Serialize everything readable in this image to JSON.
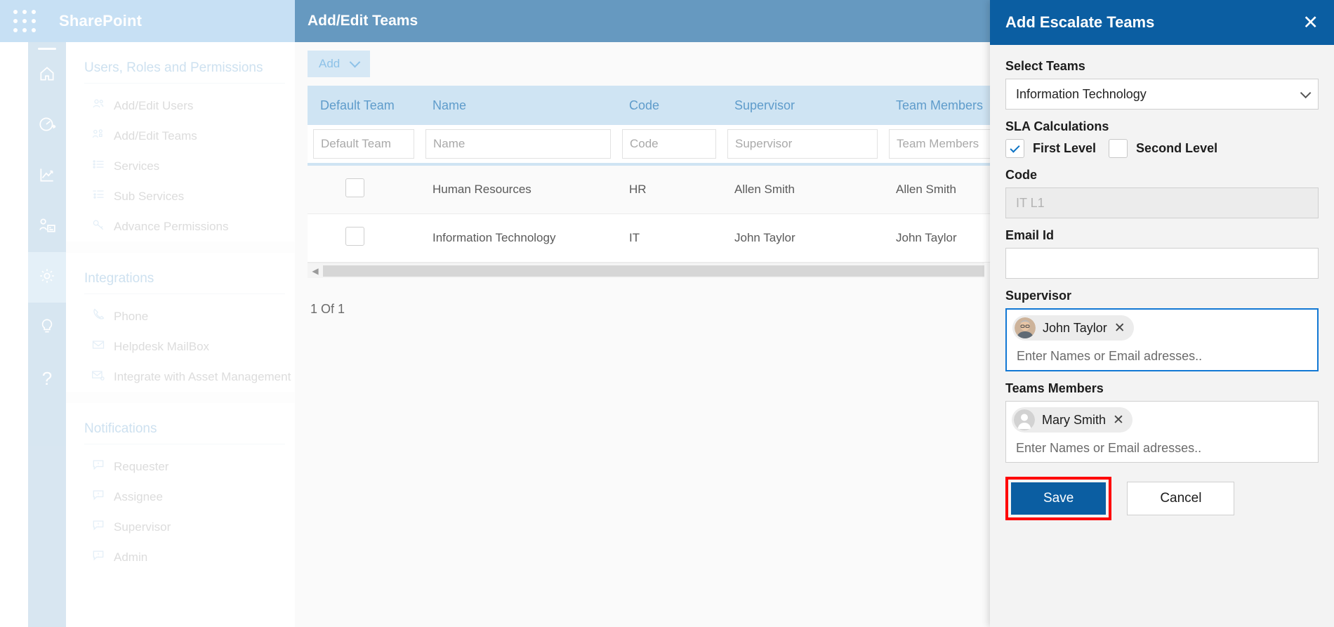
{
  "topbar": {
    "app_title": "SharePoint",
    "waffle_icon": "app-launcher-icon"
  },
  "rail": {
    "items": [
      {
        "icon": "home-icon"
      },
      {
        "icon": "dashboard-speed-icon"
      },
      {
        "icon": "analytics-chart-icon"
      },
      {
        "icon": "user-board-icon"
      },
      {
        "icon": "gear-icon",
        "active": true
      },
      {
        "icon": "lightbulb-icon"
      },
      {
        "icon": "question-mark-icon"
      }
    ]
  },
  "settings_pane": {
    "sections": [
      {
        "heading": "Users, Roles and Permissions",
        "items": [
          {
            "label": "Add/Edit Users",
            "icon": "people-icon"
          },
          {
            "label": "Add/Edit Teams",
            "icon": "team-badge-icon"
          },
          {
            "label": "Services",
            "icon": "list-icon"
          },
          {
            "label": "Sub Services",
            "icon": "sub-list-icon"
          },
          {
            "label": "Advance Permissions",
            "icon": "key-icon"
          }
        ]
      },
      {
        "heading": "Integrations",
        "items": [
          {
            "label": "Phone",
            "icon": "phone-icon"
          },
          {
            "label": "Helpdesk MailBox",
            "icon": "envelope-icon"
          },
          {
            "label": "Integrate with Asset Management",
            "icon": "envelope-gear-icon"
          }
        ]
      },
      {
        "heading": "Notifications",
        "items": [
          {
            "label": "Requester",
            "icon": "comment-alert-icon"
          },
          {
            "label": "Assignee",
            "icon": "comment-alert-icon"
          },
          {
            "label": "Supervisor",
            "icon": "comment-alert-icon"
          },
          {
            "label": "Admin",
            "icon": "comment-alert-icon"
          }
        ]
      }
    ]
  },
  "main": {
    "title": "Add/Edit Teams",
    "add_button": "Add",
    "add_chevron_icon": "chevron-down-icon",
    "columns": [
      "Default Team",
      "Name",
      "Code",
      "Supervisor",
      "Team Members"
    ],
    "filter_placeholders": [
      "Default Team",
      "Name",
      "Code",
      "Supervisor",
      "Team Members"
    ],
    "rows": [
      {
        "default_team": "",
        "name": "Human Resources",
        "code": "HR",
        "supervisor": "Allen Smith",
        "members": "Allen Smith"
      },
      {
        "default_team": "",
        "name": "Information Technology",
        "code": "IT",
        "supervisor": "John Taylor",
        "members": "John Taylor"
      }
    ],
    "scroll_left_icon": "scroll-left-arrow-icon",
    "pager": "1 Of 1"
  },
  "flyout": {
    "title": "Add Escalate Teams",
    "close_icon": "close-icon",
    "select_teams_label": "Select Teams",
    "select_teams_value": "Information Technology",
    "select_chevron_icon": "chevron-down-icon",
    "sla_label": "SLA Calculations",
    "first_level_label": "First Level",
    "first_level_checked": true,
    "second_level_label": "Second Level",
    "second_level_checked": false,
    "code_label": "Code",
    "code_placeholder": "IT L1",
    "code_value": "",
    "email_label": "Email Id",
    "email_value": "",
    "supervisor_label": "Supervisor",
    "supervisor_chip": "John Taylor",
    "supervisor_chip_avatar_icon": "photo-avatar-icon",
    "supervisor_chip_remove_icon": "remove-chip-icon",
    "supervisor_placeholder": "Enter Names or Email adresses..",
    "members_label": "Teams Members",
    "member_chip": "Mary Smith",
    "member_chip_avatar_icon": "generic-avatar-icon",
    "member_chip_remove_icon": "remove-chip-icon",
    "members_placeholder": "Enter Names or Email adresses..",
    "save_label": "Save",
    "cancel_label": "Cancel",
    "highlight_color": "#ff0000",
    "accent_color": "#0b5ea2"
  }
}
